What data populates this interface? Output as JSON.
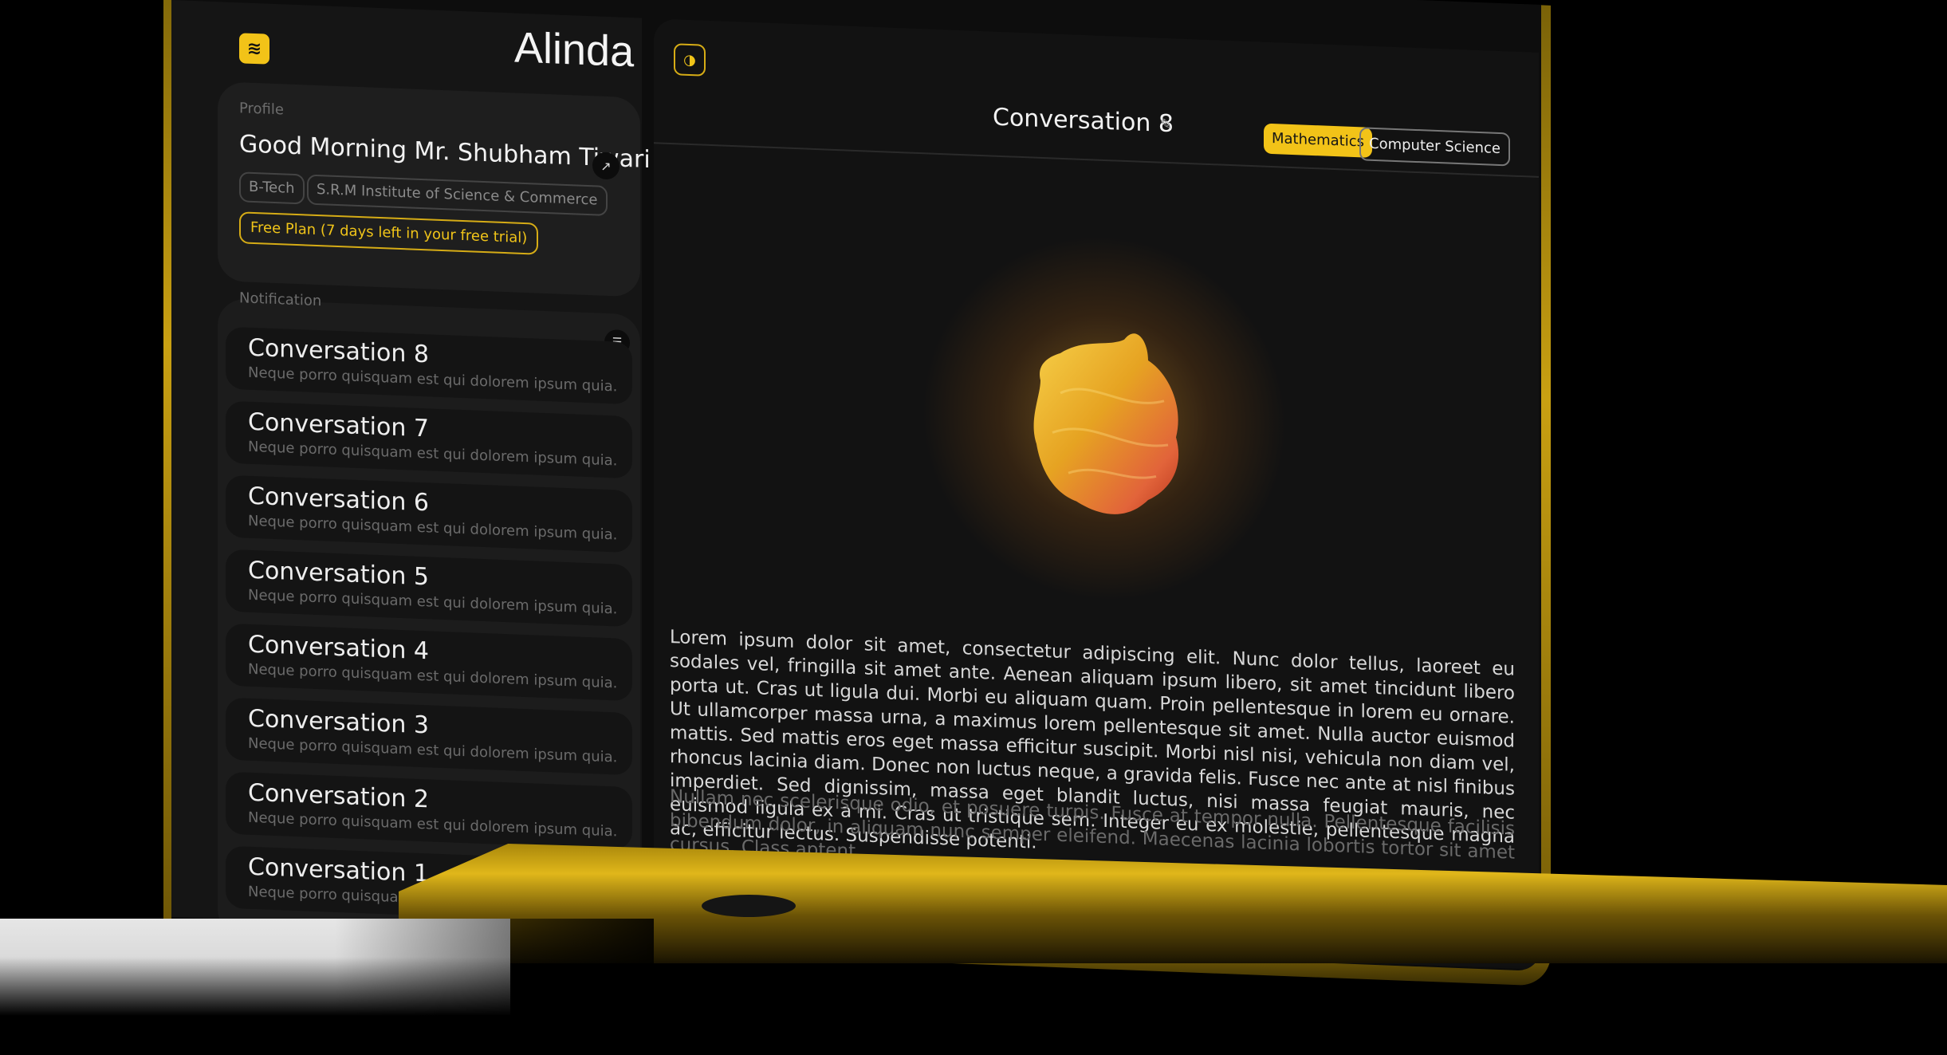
{
  "app": {
    "name": "Alinda",
    "logo_icon": "stack-logo-icon"
  },
  "profile": {
    "label": "Profile",
    "greeting": "Good Morning Mr. Shubham Tiwari",
    "degree": "B-Tech",
    "institute": "S.R.M Institute of Science & Commerce",
    "plan": "Free Plan (7 days left in your free trial)"
  },
  "notifications": {
    "label": "Notification",
    "items": [
      {
        "title": "Conversation 8",
        "snippet": "Neque porro quisquam est qui dolorem ipsum quia."
      },
      {
        "title": "Conversation 7",
        "snippet": "Neque porro quisquam est qui dolorem ipsum quia."
      },
      {
        "title": "Conversation 6",
        "snippet": "Neque porro quisquam est qui dolorem ipsum quia."
      },
      {
        "title": "Conversation 5",
        "snippet": "Neque porro quisquam est qui dolorem ipsum quia."
      },
      {
        "title": "Conversation 4",
        "snippet": "Neque porro quisquam est qui dolorem ipsum quia."
      },
      {
        "title": "Conversation 3",
        "snippet": "Neque porro quisquam est qui dolorem ipsum quia."
      },
      {
        "title": "Conversation 2",
        "snippet": "Neque porro quisquam est qui dolorem ipsum quia."
      },
      {
        "title": "Conversation 1",
        "snippet": "Neque porro quisquam est qui dolorem ipsum quia."
      }
    ]
  },
  "conversation": {
    "title": "Conversation 8",
    "tags": [
      "Mathematics",
      "Computer Science"
    ],
    "paragraph1": "Lorem ipsum dolor sit amet, consectetur adipiscing elit. Nunc dolor tellus, laoreet eu sodales vel, fringilla sit amet ante. Aenean aliquam ipsum libero, sit amet tincidunt libero porta ut. Cras ut ligula dui. Morbi eu aliquam quam. Proin pellentesque in lorem eu ornare. Ut ullamcorper massa urna, a maximus lorem pellentesque sit amet. Nulla auctor euismod mattis. Sed mattis eros eget massa efficitur suscipit. Morbi nisl nisi, vehicula non diam vel, rhoncus lacinia diam. Donec non luctus neque, a gravida felis. Fusce nec ante at nisl finibus imperdiet. Sed dignissim, massa eget blandit luctus, nisi massa feugiat mauris, nec euismod ligula ex a mi. Cras ut tristique sem. Integer eu ex molestie, pellentesque magna ac, efficitur lectus. Suspendisse potenti.",
    "paragraph2": "Nullam nec scelerisque odio, et posuere turpis. Fusce at tempor nulla. Pellentesque facilisis bibendum dolor, in aliquam nunc semper eleifend. Maecenas lacinia lobortis tortor sit amet cursus. Class aptent"
  },
  "colors": {
    "accent": "#f2c318",
    "background": "#0d0d0d",
    "card": "#1e1e1e",
    "frame_gold": "#c9a012"
  }
}
